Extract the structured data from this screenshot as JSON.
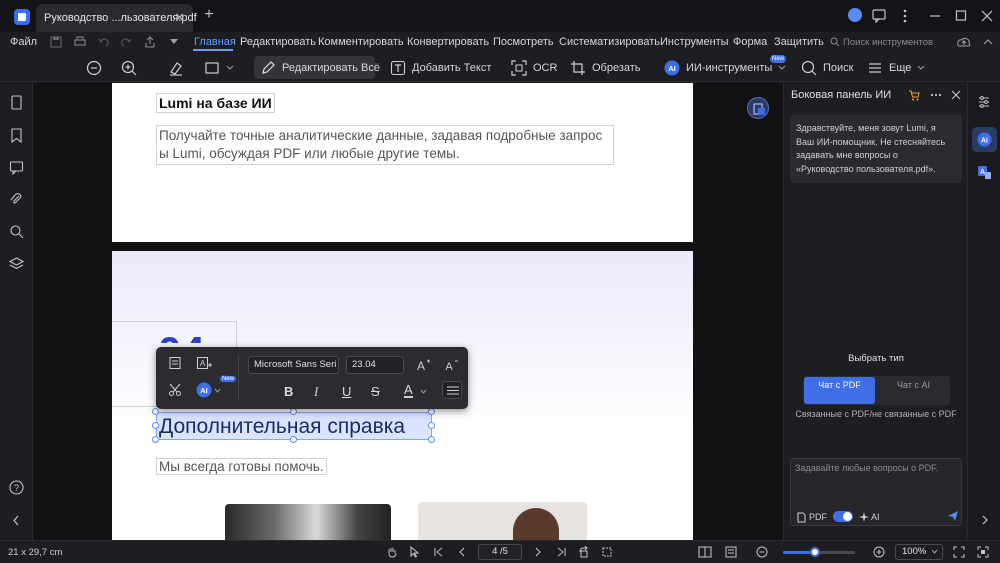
{
  "window": {
    "tab_title": "Руководство ...льзователя.pdf",
    "tab_close": "✕",
    "new_tab": "+"
  },
  "menu": {
    "file": "Файл",
    "items": [
      "Главная",
      "Редактировать",
      "Комментировать",
      "Конвертировать",
      "Посмотреть",
      "Систематизировать",
      "Инструменты",
      "Форма",
      "Защитить"
    ],
    "active_index": 0,
    "search_tools": "Поиск инструментов"
  },
  "toolbar": {
    "edit_all": "Редактировать Всё",
    "add_text": "Добавить Текст",
    "ocr": "OCR",
    "crop": "Обрезать",
    "ai_tools": "ИИ-инструменты",
    "ai_badge": "New",
    "search": "Поиск",
    "more": "Еще"
  },
  "document": {
    "lumi_title": "Lumi на базе ИИ",
    "lumi_desc": "Получайте точные аналитические данные, задавая подробные запрос ы Lumi, обсуждая PDF или любые другие темы.",
    "big_number": "04",
    "heading": "Дополнительная справка",
    "subtext": "Мы всегда готовы помочь."
  },
  "format_toolbar": {
    "font_name": "Microsoft Sans Seri",
    "font_size": "23.04",
    "ai_badge": "New",
    "bold": "B",
    "italic": "I",
    "underline": "U",
    "strike": "S",
    "color": "A"
  },
  "ai_panel": {
    "title": "Боковая панель ИИ",
    "greeting": "Здравствуйте, меня зовут Lumi, я Ваш ИИ-помощник. Не стесняйтесь задавать мне вопросы о «Руководство пользователя.pdf».",
    "choose_type": "Выбрать тип",
    "type_pdf": "Чат с PDF",
    "type_ai": "Чат с AI",
    "type_hint": "Связанные с PDF/не связанные с PDF",
    "input_placeholder": "Задавайте любые вопросы о PDF.",
    "pdf_label": "PDF",
    "ai_label": "AI"
  },
  "status": {
    "page_size": "21 x 29,7 cm",
    "page_indicator": "4 /5",
    "zoom": "100%",
    "zoom_fraction": 0.45
  },
  "colors": {
    "accent": "#6a9cff",
    "primary_button": "#3f6fe6",
    "heading_ink": "#1b2a6b"
  }
}
